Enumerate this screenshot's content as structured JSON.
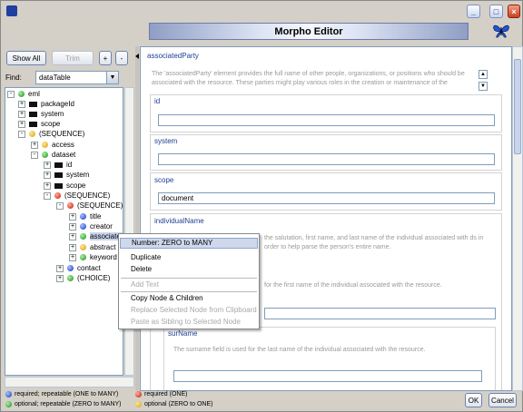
{
  "window": {
    "title": "Morpho Editor",
    "controls": [
      "minimize-icon",
      "maximize-icon",
      "close-icon"
    ]
  },
  "left_panel": {
    "show_all": "Show All",
    "trim": "Trim",
    "plus": "+",
    "minus": "-",
    "find_label": "Find:",
    "find_value": "dataTable"
  },
  "tree": {
    "eml": "eml",
    "packageId": "packageId",
    "system": "system",
    "scope": "scope",
    "seq1": "(SEQUENCE)",
    "access": "access",
    "dataset": "dataset",
    "ds_id": "id",
    "ds_system": "system",
    "ds_scope": "scope",
    "seq2": "(SEQUENCE)",
    "seq3": "(SEQUENCE)",
    "title": "title",
    "creator": "creator",
    "associated": "associatedP",
    "abstract": "abstract",
    "keyword": "keyword",
    "contact": "contact",
    "choice": "(CHOICE)"
  },
  "editor": {
    "section_title": "associatedParty",
    "section_desc": "The 'associatedParty' element provides the full name of other people, organizations, or positions who should be associated with the resource. These parties might play various roles in the creation or maintenance of the resource, and these roles should be indicated in the 'role' element.",
    "id_label": "id",
    "id_value": "",
    "system_label": "system",
    "system_value": "",
    "scope_label": "scope",
    "scope_value": "document",
    "individual_label": "individualName",
    "individual_desc": "the salutation, first name, and last name of the individual associated with ds in order to help parse the person's entire name.",
    "given_desc": "for the first name of the individual associated with the resource.",
    "surname_label": "surName",
    "surname_desc": "The surname field is used for the last name of the individual associated with the resource."
  },
  "context_menu": {
    "items": [
      "Number: ZERO to MANY",
      "Duplicate",
      "Delete",
      "Add Text",
      "Copy Node & Children",
      "Replace Selected Node from Clipboard",
      "Paste as Sibling to Selected Node"
    ]
  },
  "legend": {
    "req_rep": "required; repeatable (ONE to MANY)",
    "req_one": "required (ONE)",
    "opt_rep": "optional; repeatable (ZERO to MANY)",
    "opt_one": "optional (ZERO to ONE)"
  },
  "buttons": {
    "ok": "OK",
    "cancel": "Cancel"
  },
  "colors": {
    "label_blue": "#1c3f94",
    "required_one": "#109010",
    "required_repeat": "#111111",
    "optional": "#d8a000",
    "red": "#c81000",
    "blue": "#1030c8"
  }
}
